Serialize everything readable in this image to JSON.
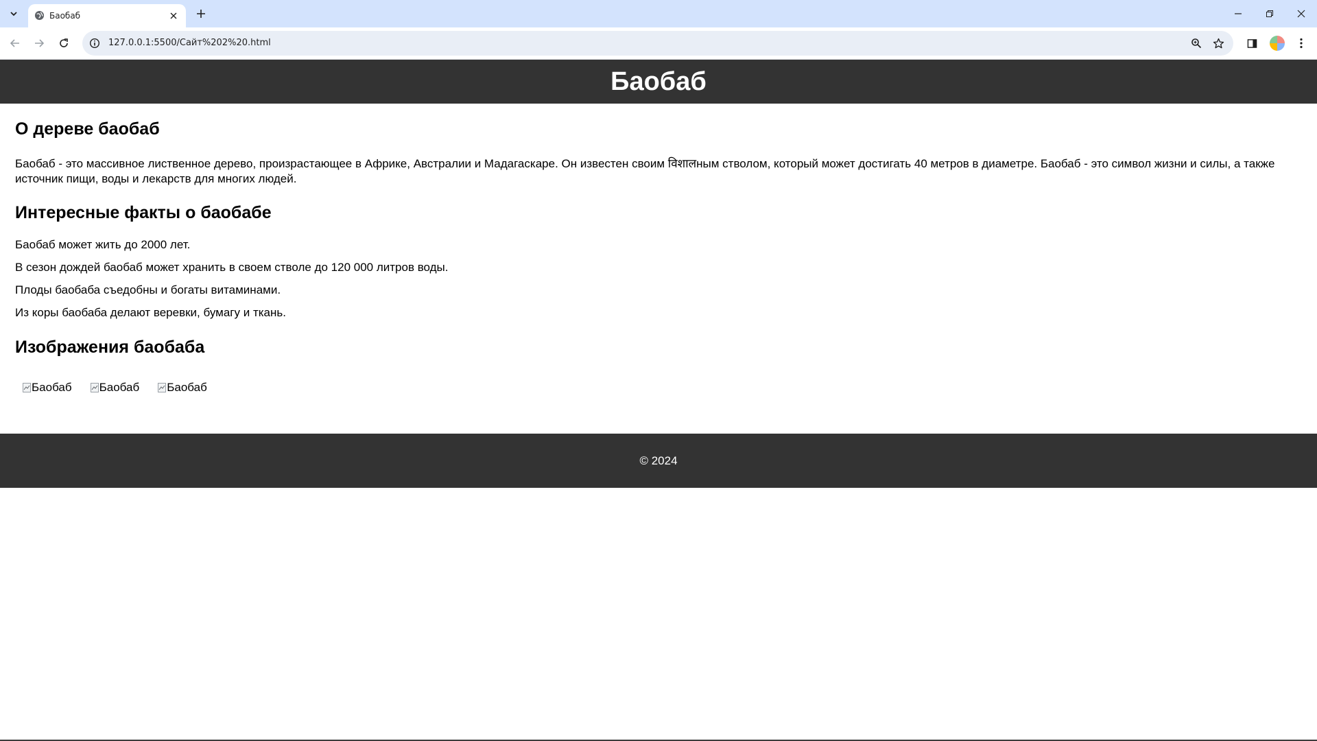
{
  "browser": {
    "tab_title": "Баобаб",
    "url": "127.0.0.1:5500/Сайт%202%20.html"
  },
  "page": {
    "header_title": "Баобаб",
    "about": {
      "heading": "О дереве баобаб",
      "text": "Баобаб - это массивное лиственное дерево, произрастающее в Африке, Австралии и Мадагаскаре. Он известен своим विशालным стволом, который может достигать 40 метров в диаметре. Баобаб - это символ жизни и силы, а также источник пищи, воды и лекарств для многих людей."
    },
    "facts": {
      "heading": "Интересные факты о баобабе",
      "items": [
        "Баобаб может жить до 2000 лет.",
        "В сезон дождей баобаб может хранить в своем стволе до 120 000 литров воды.",
        "Плоды баобаба съедобны и богаты витаминами.",
        "Из коры баобаба делают веревки, бумагу и ткань."
      ]
    },
    "images": {
      "heading": "Изображения баобаба",
      "alts": [
        "Баобаб",
        "Баобаб",
        "Баобаб"
      ]
    },
    "footer_text": "© 2024"
  },
  "colors": {
    "header_bg": "#333333",
    "footer_bg": "#333333",
    "tabstrip_bg": "#d3e3fd",
    "omnibox_bg": "#e9eef6"
  },
  "icons": [
    "tab-search-icon",
    "globe-icon",
    "close-icon",
    "plus-icon",
    "minimize-icon",
    "restore-icon",
    "window-close-icon",
    "back-icon",
    "forward-icon",
    "reload-icon",
    "info-icon",
    "zoom-icon",
    "star-icon",
    "side-panel-icon",
    "menu-icon",
    "broken-image-icon"
  ]
}
